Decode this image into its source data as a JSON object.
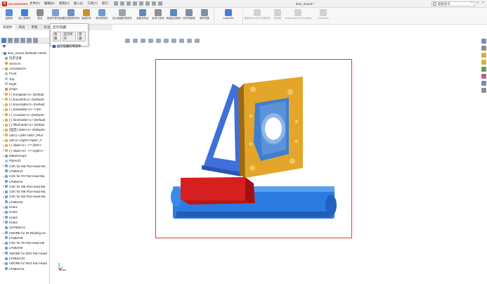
{
  "app": {
    "logo_text": "SOLIDWORKS",
    "document_title": "lens_mount *",
    "search_placeholder": "搜索命令"
  },
  "menu": [
    "文件(F)",
    "编辑(E)",
    "视图(V)",
    "插入(I)",
    "工具(T)",
    "窗口"
  ],
  "ribbon": [
    {
      "label": "装配体",
      "icon": "assembly-icon",
      "color": "#5a8bd6",
      "dim": false
    },
    {
      "label": "插入零部件",
      "icon": "insert-component-icon",
      "color": "#3f7fd8",
      "dim": false
    },
    {
      "label": "配合",
      "icon": "mate-icon",
      "color": "#8c8c8c",
      "dim": false
    },
    {
      "label": "零部件预览窗口",
      "icon": "preview-window-icon",
      "color": "#7aa0d8",
      "dim": false
    },
    {
      "label": "线性零部件阵列",
      "icon": "linear-pattern-icon",
      "color": "#6b8fc7",
      "dim": false
    },
    {
      "label": "智能扣件",
      "icon": "smart-fastener-icon",
      "color": "#c8902c",
      "dim": false
    },
    {
      "label": "移动零部件",
      "icon": "move-component-icon",
      "color": "#6b9bd8",
      "dim": false
    },
    {
      "label": "显示隐藏的零部件",
      "icon": "show-hidden-icon",
      "color": "#9aa4ad",
      "dim": false
    },
    {
      "label": "装配体特征",
      "icon": "assembly-feature-icon",
      "color": "#5e88c0",
      "dim": false
    },
    {
      "label": "参考几何体",
      "icon": "reference-geometry-icon",
      "color": "#8f8f8f",
      "dim": false
    },
    {
      "label": "新建运动算例",
      "icon": "new-motion-study-icon",
      "color": "#5e88c0",
      "dim": false
    },
    {
      "label": "材料明细表",
      "icon": "bom-icon",
      "color": "#7d8fa3",
      "dim": false
    },
    {
      "label": "爆炸视图",
      "icon": "exploded-view-icon",
      "color": "#7d8fa3",
      "dim": false
    },
    {
      "label": "Instant3D",
      "icon": "instant3d-icon",
      "color": "#4c7dd0",
      "dim": false
    },
    {
      "label": "更新Speedpak子装配体",
      "icon": "speedpak-icon",
      "color": "#a3a3a3",
      "dim": true
    },
    {
      "label": "拍快照",
      "icon": "snapshot-icon",
      "color": "#a3a3a3",
      "dim": true
    },
    {
      "label": "Large Assembly Settings",
      "icon": "large-assembly-icon",
      "color": "#a3a3a3",
      "dim": true
    },
    {
      "label": "Defeature",
      "icon": "defeature-icon",
      "color": "#a3a3a3",
      "dim": true
    }
  ],
  "command_tabs": [
    "装配体",
    "布局",
    "草图",
    "标注",
    "评估",
    "MBD"
  ],
  "popup": {
    "title": "显示/隐藏",
    "btn1": "隐藏",
    "btn2": "显示所有",
    "btn3": "隐藏",
    "checkbox_label": "显示隐藏的零部件"
  },
  "tree": [
    {
      "label": "lens_mount (Default<<Defa",
      "color": "#4f7bc8",
      "expand": "▾"
    },
    {
      "label": "历史记录",
      "color": "#9aa6b2",
      "expand": ""
    },
    {
      "label": "Sensors",
      "color": "#caa24a",
      "expand": ""
    },
    {
      "label": "Annotations",
      "color": "#d0a43c",
      "expand": "▸"
    },
    {
      "label": "Front",
      "color": "#b7c2cf",
      "expand": ""
    },
    {
      "label": "Top",
      "color": "#b7c2cf",
      "expand": ""
    },
    {
      "label": "Right",
      "color": "#b7c2cf",
      "expand": ""
    },
    {
      "label": "Origin",
      "color": "#e08a3a",
      "expand": ""
    },
    {
      "label": "(-) frontplate<1> (Default",
      "color": "#d9b04a",
      "expand": "▸"
    },
    {
      "label": "(-) braceleft<1> (Default<",
      "color": "#d9b04a",
      "expand": "▸"
    },
    {
      "label": "(-) braceright<1> (Default",
      "color": "#d9b04a",
      "expand": "▸"
    },
    {
      "label": "(-) baseplate<1> <<De",
      "color": "#d9b04a",
      "expand": "▸"
    },
    {
      "label": "(-) crossbar<1> (Default<",
      "color": "#d9b04a",
      "expand": "▸"
    },
    {
      "label": "(-) lensholder<1> (Default",
      "color": "#d9b04a",
      "expand": "▸"
    },
    {
      "label": "(-) filterholder<1> (Defaul",
      "color": "#d9b04a",
      "expand": "▸"
    },
    {
      "label": "(固定) slider<1> (Default<",
      "color": "#d9b04a",
      "expand": "▸"
    },
    {
      "label": "rail<1> (left<<left>_Phot",
      "color": "#d9b04a",
      "expand": "▸"
    },
    {
      "label": "rail<2> (right<<right>_F",
      "color": "#d9b04a",
      "expand": "▸"
    },
    {
      "label": "(-) slider<1> ->? (left<<",
      "color": "#d9b04a",
      "expand": "▸"
    },
    {
      "label": "(-) slider<3> ->? (right<<",
      "color": "#d9b04a",
      "expand": "▸"
    },
    {
      "label": "MateGroup1",
      "color": "#8aa0b8",
      "expand": "▸"
    },
    {
      "label": "Plane23",
      "color": "#b7c2cf",
      "expand": ""
    },
    {
      "label": "CSK for M5 Flat Head Ma",
      "color": "#6fa0d8",
      "expand": "▸"
    },
    {
      "label": "LPattern3",
      "color": "#6fa0d8",
      "expand": ""
    },
    {
      "label": "CSK for #3 Flat Head Ma",
      "color": "#6fa0d8",
      "expand": "▸"
    },
    {
      "label": "LPattern4",
      "color": "#6fa0d8",
      "expand": ""
    },
    {
      "label": "CSK for M5 Flat Head Ma",
      "color": "#6fa0d8",
      "expand": "▸"
    },
    {
      "label": "CSK for M5 Flat Head Ma",
      "color": "#6fa0d8",
      "expand": "▸"
    },
    {
      "label": "CSK for M4 Flat Head Ma",
      "color": "#6fa0d8",
      "expand": "▸"
    },
    {
      "label": "LPattern5",
      "color": "#6fa0d8",
      "expand": ""
    },
    {
      "label": "Hole1",
      "color": "#6fa0d8",
      "expand": "▸"
    },
    {
      "label": "Hole2",
      "color": "#6fa0d8",
      "expand": "▸"
    },
    {
      "label": "Hole3",
      "color": "#6fa0d8",
      "expand": "▸"
    },
    {
      "label": "Hole4",
      "color": "#6fa0d8",
      "expand": "▸"
    },
    {
      "label": "CirPattern1",
      "color": "#6fa0d8",
      "expand": ""
    },
    {
      "label": "CBORE for #5 Binding Ho",
      "color": "#6fa0d8",
      "expand": "▸"
    },
    {
      "label": "LPattern8",
      "color": "#6fa0d8",
      "expand": ""
    },
    {
      "label": "CSK for #6 Flat Head Ma",
      "color": "#6fa0d8",
      "expand": "▸"
    },
    {
      "label": "LPattern9",
      "color": "#6fa0d8",
      "expand": ""
    },
    {
      "label": "CBORE for M10 Pan Head",
      "color": "#6fa0d8",
      "expand": "▸"
    },
    {
      "label": "LPattern10",
      "color": "#6fa0d8",
      "expand": ""
    },
    {
      "label": "CBORE for M10 Pan Head",
      "color": "#6fa0d8",
      "expand": "▸"
    },
    {
      "label": "LPattern11",
      "color": "#6fa0d8",
      "expand": ""
    }
  ],
  "colors": {
    "frontplate": "#e3a52a",
    "brace": "#3f6fd8",
    "lensholder": "#5b93d8",
    "slider": "#d81f1f",
    "rail": "#2b7be0",
    "selection": "#e03a3a"
  }
}
